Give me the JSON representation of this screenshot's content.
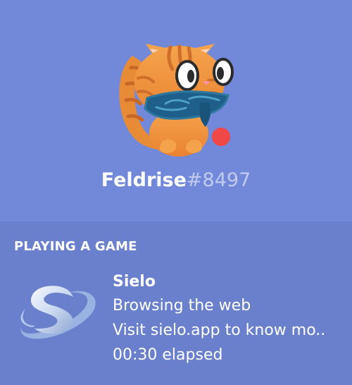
{
  "profile": {
    "username": "Feldrise",
    "discriminator": "#8497",
    "status_color": "#f04747",
    "avatar_icon": "cat-avatar-icon"
  },
  "activity": {
    "header": "PLAYING A GAME",
    "game_icon": "sielo-logo-icon",
    "game_name": "Sielo",
    "details": "Browsing the web",
    "state": "Visit sielo.app to know mo..",
    "elapsed": "00:30 elapsed"
  },
  "colors": {
    "blurple": "#7289da",
    "activity_background": "#6a80cc",
    "text_white": "#ffffff",
    "status_red": "#f04747"
  }
}
